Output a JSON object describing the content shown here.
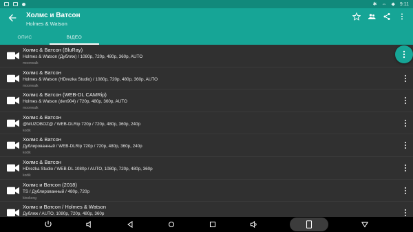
{
  "status_bar": {
    "time": "9:11"
  },
  "app_bar": {
    "title": "Холмс и Ватсон",
    "subtitle": "Holmes & Watson"
  },
  "tabs": [
    {
      "label": "ОПИС",
      "active": false
    },
    {
      "label": "ВІДЕО",
      "active": true
    }
  ],
  "videos": [
    {
      "title": "Холмс & Ватсон (BluRay)",
      "details": "Holmes & Watson (Дубляж) / 1080p, 720p, 480p, 360p, AUTO",
      "source": "moonwalk"
    },
    {
      "title": "Холмс & Ватсон",
      "details": "Holmes & Watson (HDrezka Studio) / 1080p, 720p, 480p, 360p, AUTO",
      "source": "moonwalk"
    },
    {
      "title": "Холмс & Ватсон (WEB-DL CAMRip)",
      "details": "Holmes & Watson (den904) / 720p, 480p, 360p, AUTO",
      "source": "moonwalk"
    },
    {
      "title": "Холмс & Ватсон",
      "details": "@MUZOBOZ@ / WEB-DLRip 720p / 720p, 480p, 360p, 240p",
      "source": "kodik"
    },
    {
      "title": "Холмс & Ватсон",
      "details": "Дублированный / WEB-DLRip 720p / 720p, 480p, 360p, 240p",
      "source": "kodik"
    },
    {
      "title": "Холмс & Ватсон",
      "details": "HDrezka Studio / WEB-DL 1080p / AUTO, 1080p, 720p, 480p, 360p",
      "source": "kodik"
    },
    {
      "title": "Холмс и Ватсон (2018)",
      "details": "TS / Дублированный / 480p, 720p",
      "source": "kinokong"
    },
    {
      "title": "Холмс и Ватсон / Holmes & Watson",
      "details": "Дубляж / AUTO, 1080p, 720p, 480p, 360p",
      "source": ""
    }
  ],
  "icons": {
    "back": "arrow-left-icon",
    "favorite": "star-outline-icon",
    "people": "people-icon",
    "share": "share-icon",
    "overflow": "more-vertical-icon",
    "video": "videocam-icon"
  },
  "colors": {
    "primary": "#16a596",
    "status_bar": "#11897b",
    "background": "#303030"
  }
}
